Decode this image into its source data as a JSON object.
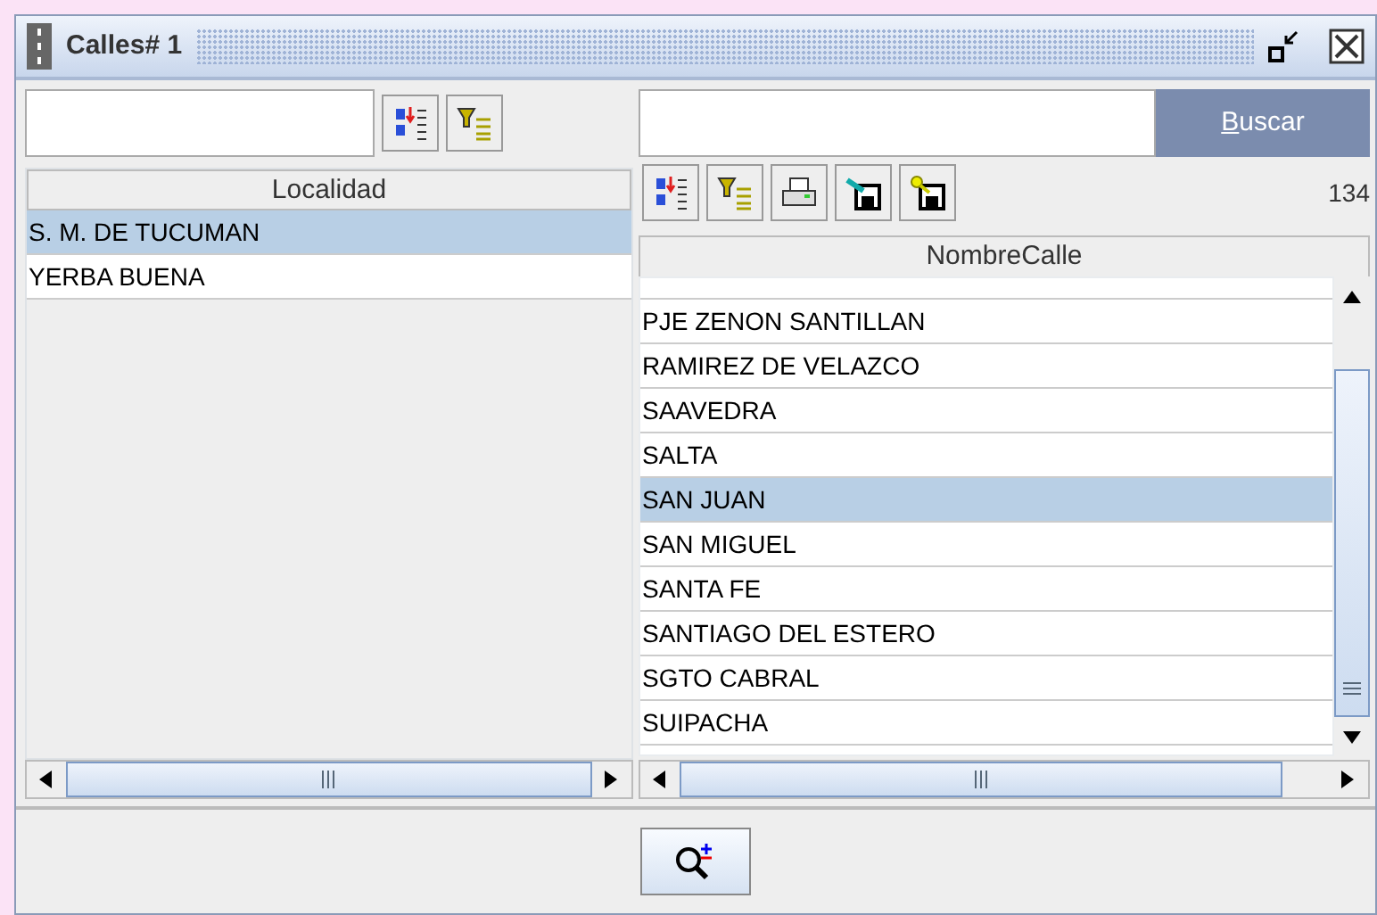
{
  "window": {
    "title": "Calles# 1"
  },
  "left_panel": {
    "table": {
      "columns": [
        "Localidad"
      ],
      "rows": [
        {
          "cells": [
            "S. M. DE TUCUMAN"
          ],
          "selected": true
        },
        {
          "cells": [
            "YERBA BUENA"
          ],
          "selected": false
        }
      ]
    }
  },
  "right_panel": {
    "search_button": {
      "label": "Buscar",
      "mnemonic": true
    },
    "record_count": "134",
    "table": {
      "columns": [
        "NombreCalle"
      ],
      "rows": [
        {
          "cells": [
            "PJE ZENON SANTILLAN"
          ],
          "selected": false
        },
        {
          "cells": [
            "RAMIREZ DE VELAZCO"
          ],
          "selected": false
        },
        {
          "cells": [
            "SAAVEDRA"
          ],
          "selected": false
        },
        {
          "cells": [
            "SALTA"
          ],
          "selected": false
        },
        {
          "cells": [
            "SAN JUAN"
          ],
          "selected": true
        },
        {
          "cells": [
            "SAN MIGUEL"
          ],
          "selected": false
        },
        {
          "cells": [
            "SANTA FE"
          ],
          "selected": false
        },
        {
          "cells": [
            "SANTIAGO DEL ESTERO"
          ],
          "selected": false
        },
        {
          "cells": [
            "SGTO CABRAL"
          ],
          "selected": false
        },
        {
          "cells": [
            "SUIPACHA"
          ],
          "selected": false
        }
      ]
    }
  }
}
